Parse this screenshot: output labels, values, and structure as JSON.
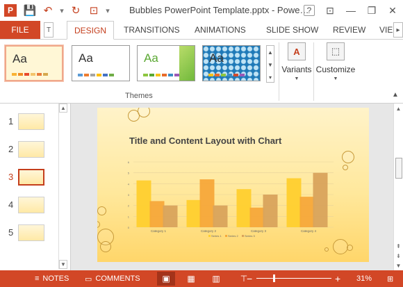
{
  "window": {
    "title": "Bubbles PowerPoint Template.pptx - Powe…",
    "controls": {
      "help": "?",
      "minimize": "—",
      "restore": "❐",
      "close": "✕"
    }
  },
  "quick_access": [
    {
      "name": "app-logo-icon",
      "glyph": "P"
    },
    {
      "name": "save-icon",
      "glyph": "💾"
    },
    {
      "name": "undo-icon",
      "glyph": "↶"
    },
    {
      "name": "undo-dropdown-icon",
      "glyph": "▾"
    },
    {
      "name": "redo-icon",
      "glyph": "↻"
    },
    {
      "name": "start-from-beginning-icon",
      "glyph": "⊡"
    },
    {
      "name": "customize-qa-icon",
      "glyph": "▾"
    }
  ],
  "tabs": {
    "file": "FILE",
    "scroll_left": "◂",
    "partial_left": "T",
    "items": [
      "DESIGN",
      "TRANSITIONS",
      "ANIMATIONS",
      "SLIDE SHOW",
      "REVIEW",
      "VIE"
    ],
    "active": "DESIGN",
    "scroll_right": "▸"
  },
  "ribbon": {
    "themes_group_label": "Themes",
    "themes": [
      {
        "label": "Aa",
        "selected": true,
        "bg": "#fff7d6",
        "swatches": [
          "#f9b233",
          "#f08a24",
          "#e8492d",
          "#f3c46a",
          "#e97b3b",
          "#d6a84d"
        ]
      },
      {
        "label": "Aa",
        "selected": false,
        "bg": "#ffffff",
        "swatches": [
          "#5b9bd5",
          "#ed7d31",
          "#a5a5a5",
          "#ffc000",
          "#4472c4",
          "#70ad47"
        ]
      },
      {
        "label": "Aa",
        "selected": false,
        "bg": "#ffffff",
        "swatches": [
          "#8dc63f",
          "#5aa832",
          "#f7c31b",
          "#e86b2a",
          "#3a8dc6",
          "#9b59b6"
        ]
      },
      {
        "label": "Aa",
        "selected": false,
        "bg": "#1f7ab8",
        "swatches": [
          "#f7c31b",
          "#e86b2a",
          "#8dc63f",
          "#3a8dc6",
          "#d04a2a",
          "#9b59b6"
        ]
      }
    ],
    "gallery_scroll": [
      "▲",
      "▼",
      "▾"
    ],
    "variants": {
      "label": "Variants",
      "icon": "variants-icon",
      "glyph": "A"
    },
    "customize": {
      "label": "Customize",
      "icon": "customize-icon",
      "glyph": "⬚"
    }
  },
  "slides": {
    "numbers": [
      "1",
      "2",
      "3",
      "4",
      "5"
    ],
    "active": "3"
  },
  "slide": {
    "title": "Title and Content Layout with Chart"
  },
  "chart_data": {
    "type": "bar",
    "categories": [
      "Category 1",
      "Category 2",
      "Category 3",
      "Category 4"
    ],
    "series": [
      {
        "name": "Series 1",
        "values": [
          4.3,
          2.5,
          3.5,
          4.5
        ],
        "color": "#ffcf2e"
      },
      {
        "name": "Series 2",
        "values": [
          2.4,
          4.4,
          1.8,
          2.8
        ],
        "color": "#f7a83a"
      },
      {
        "name": "Series 3",
        "values": [
          2,
          2,
          3,
          5
        ],
        "color": "#d9a35c"
      }
    ],
    "ylim": [
      0,
      6
    ],
    "yticks": [
      "0",
      "1",
      "2",
      "3",
      "4",
      "5",
      "6"
    ],
    "grid": true,
    "legend": "bottom"
  },
  "statusbar": {
    "notes": "NOTES",
    "comments": "COMMENTS",
    "zoom_out": "−",
    "zoom_in": "+",
    "zoom": "31%",
    "zoom_fraction": 0.31
  }
}
